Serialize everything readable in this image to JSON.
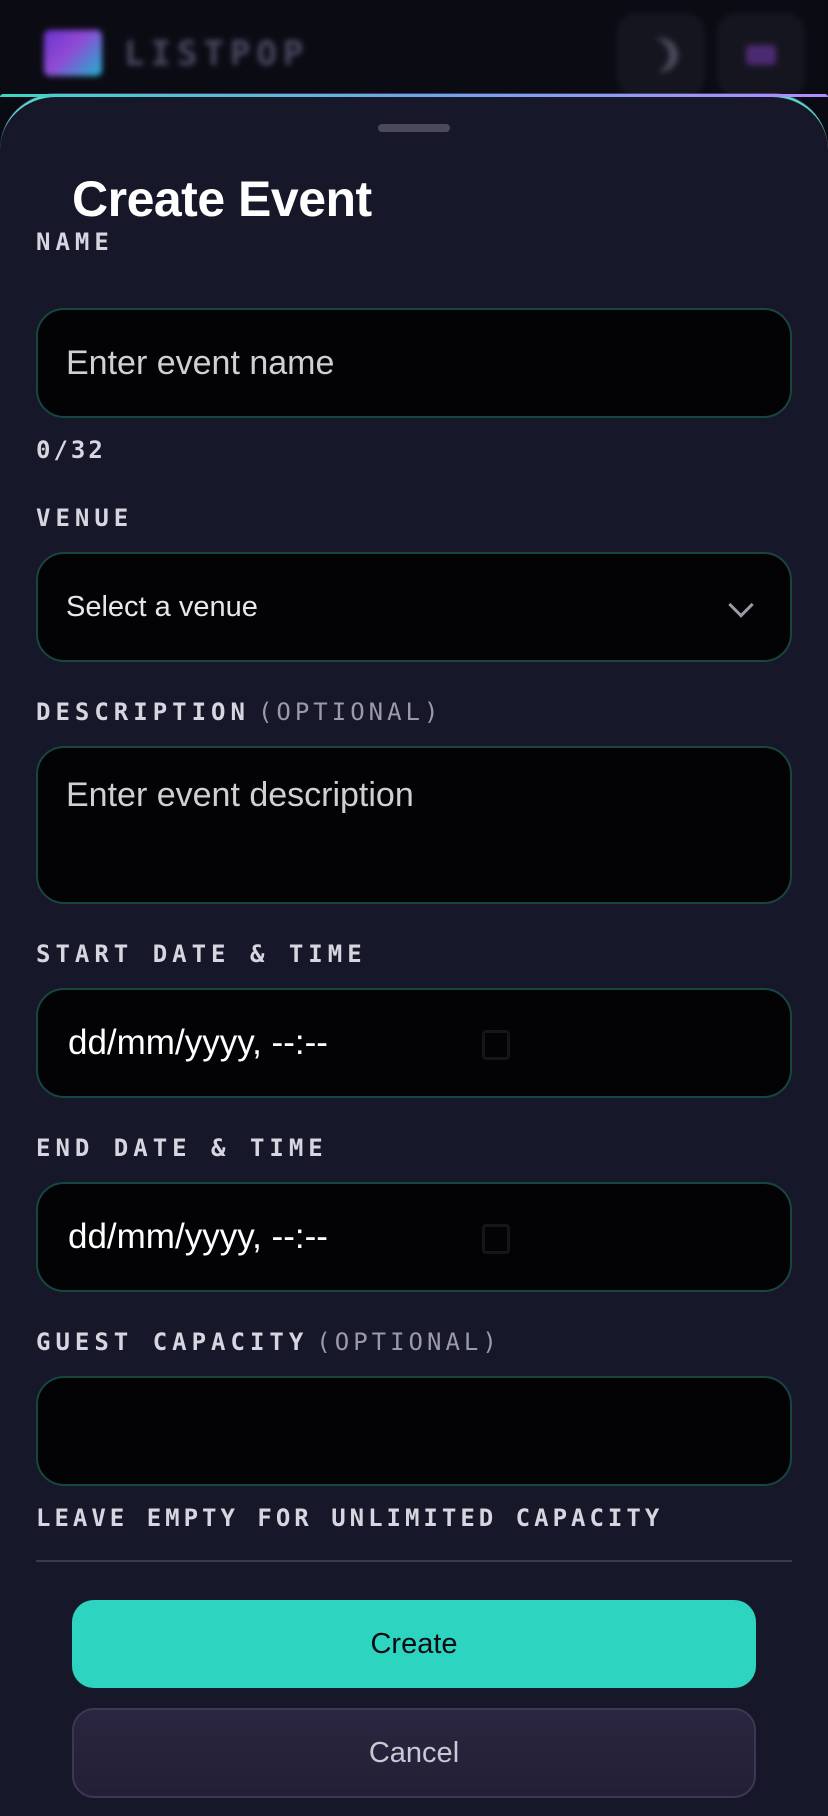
{
  "header": {
    "brand": "LISTPOP"
  },
  "sheet": {
    "title": "Create Event"
  },
  "form": {
    "name": {
      "label": "NAME",
      "placeholder": "Enter event name",
      "counter": "0/32"
    },
    "venue": {
      "label": "VENUE",
      "selected": "Select a venue"
    },
    "description": {
      "label": "DESCRIPTION",
      "optional": "(OPTIONAL)",
      "placeholder": "Enter event description"
    },
    "start": {
      "label": "START DATE & TIME",
      "value": "dd/mm/yyyy, --:--"
    },
    "end": {
      "label": "END DATE & TIME",
      "value": "dd/mm/yyyy, --:--"
    },
    "capacity": {
      "label": "GUEST CAPACITY",
      "optional": "(OPTIONAL)",
      "hint": "LEAVE EMPTY FOR UNLIMITED CAPACITY"
    }
  },
  "actions": {
    "create_label": "Create",
    "cancel_label": "Cancel"
  },
  "icons": {
    "theme": "moon-icon",
    "select": "chevron-down-icon",
    "date": "calendar-icon"
  },
  "colors": {
    "accent": "#2dd4bf",
    "sheet_bg": "#17172a",
    "field_border": "#17463f"
  }
}
